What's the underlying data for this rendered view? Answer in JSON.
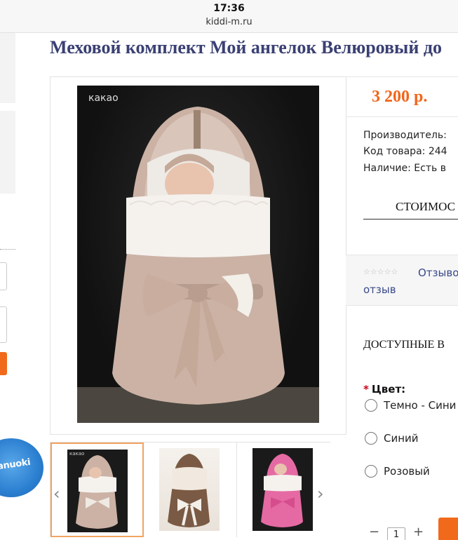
{
  "status_bar": {
    "time": "17:36",
    "url": "kiddi-m.ru"
  },
  "product": {
    "title": "Меховой комплект Мой ангелок Велюровый до",
    "price": "3 200 р.",
    "info": {
      "manufacturer": "Производитель:",
      "code": "Код товара: 244",
      "availability": "Наличие: Есть в"
    },
    "calc_label": "СТОИМОС",
    "reviews": {
      "link": "Отзыво",
      "link2": "отзыв",
      "stars": "☆☆☆☆☆"
    },
    "options_title": "ДОСТУПНЫЕ В",
    "color_label": "Цвет:",
    "color_required_mark": "*",
    "colors": [
      "Темно - Сини",
      "Синий",
      "Розовый"
    ],
    "quantity": "1",
    "qty_minus": "−",
    "qty_plus": "+"
  },
  "gallery": {
    "main_caption": "какао",
    "thumb_caption": "какао",
    "prev_arrow": "‹",
    "next_arrow": "›"
  },
  "sidebar": {
    "brand_logo_text": "anuoki"
  },
  "colors_ui": {
    "accent": "#f16a1b",
    "price": "#f2661a",
    "title": "#3a4073",
    "link": "#3a4a8a"
  }
}
